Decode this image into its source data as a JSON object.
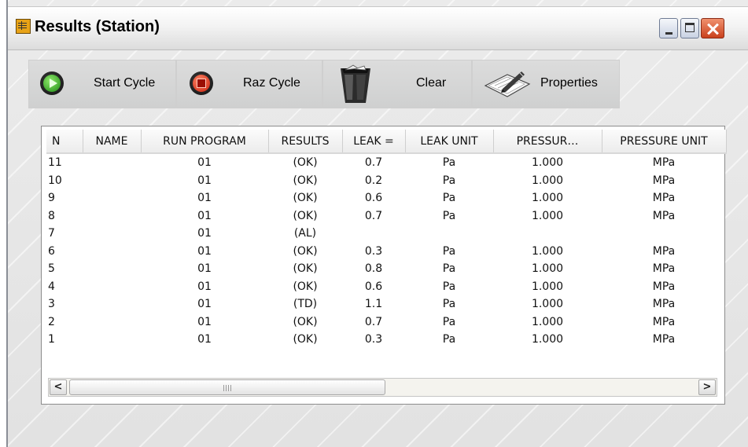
{
  "window": {
    "title": "Results (Station)"
  },
  "toolbar": {
    "start_cycle": "Start Cycle",
    "raz_cycle": "Raz Cycle",
    "clear": "Clear",
    "properties": "Properties"
  },
  "grid": {
    "columns": [
      "N",
      "NAME",
      "RUN PROGRAM",
      "RESULTS",
      "LEAK =",
      "LEAK UNIT",
      "PRESSUR…",
      "PRESSURE UNIT"
    ],
    "rows": [
      [
        "11",
        "",
        "01",
        "(OK)",
        "0.7",
        "Pa",
        "1.000",
        "MPa"
      ],
      [
        "10",
        "",
        "01",
        "(OK)",
        "0.2",
        "Pa",
        "1.000",
        "MPa"
      ],
      [
        "9",
        "",
        "01",
        "(OK)",
        "0.6",
        "Pa",
        "1.000",
        "MPa"
      ],
      [
        "8",
        "",
        "01",
        "(OK)",
        "0.7",
        "Pa",
        "1.000",
        "MPa"
      ],
      [
        "7",
        "",
        "01",
        "(AL)",
        "",
        "",
        "",
        ""
      ],
      [
        "6",
        "",
        "01",
        "(OK)",
        "0.3",
        "Pa",
        "1.000",
        "MPa"
      ],
      [
        "5",
        "",
        "01",
        "(OK)",
        "0.8",
        "Pa",
        "1.000",
        "MPa"
      ],
      [
        "4",
        "",
        "01",
        "(OK)",
        "0.6",
        "Pa",
        "1.000",
        "MPa"
      ],
      [
        "3",
        "",
        "01",
        "(TD)",
        "1.1",
        "Pa",
        "1.000",
        "MPa"
      ],
      [
        "2",
        "",
        "01",
        "(OK)",
        "0.7",
        "Pa",
        "1.000",
        "MPa"
      ],
      [
        "1",
        "",
        "01",
        "(OK)",
        "0.3",
        "Pa",
        "1.000",
        "MPa"
      ]
    ]
  },
  "scrollbar": {
    "left_arrow": "<",
    "right_arrow": ">"
  },
  "icons": {
    "title": "table-icon",
    "start_cycle": "play-icon",
    "raz_cycle": "stop-icon",
    "clear": "trash-bin-icon",
    "properties": "properties-pen-icon"
  },
  "colors": {
    "play": "#2fae1f",
    "stop": "#d42a12",
    "close_button": "#d9532b"
  }
}
